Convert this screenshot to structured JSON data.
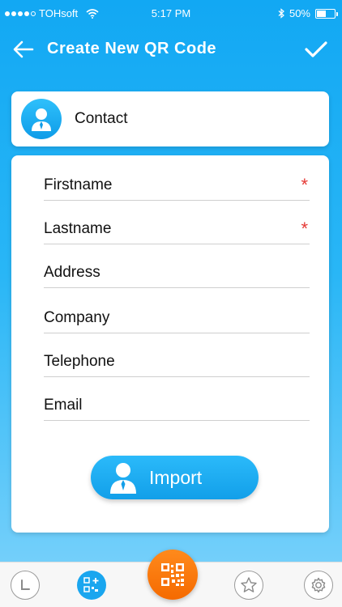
{
  "status_bar": {
    "carrier": "TOHsoft",
    "time": "5:17 PM",
    "battery_percent": "50%",
    "battery_level": 0.5
  },
  "header": {
    "title": "Create New QR Code",
    "back_icon": "arrow-left-icon",
    "confirm_icon": "checkmark-icon"
  },
  "type_card": {
    "label": "Contact",
    "icon": "person-icon"
  },
  "form": {
    "fields": [
      {
        "placeholder": "Firstname",
        "value": "",
        "required": true
      },
      {
        "placeholder": "Lastname",
        "value": "",
        "required": true
      },
      {
        "placeholder": "Address",
        "value": "",
        "required": false
      },
      {
        "placeholder": "Company",
        "value": "",
        "required": false
      },
      {
        "placeholder": "Telephone",
        "value": "",
        "required": false
      },
      {
        "placeholder": "Email",
        "value": "",
        "required": false
      }
    ],
    "required_mark": "*",
    "import_button": {
      "label": "Import",
      "icon": "person-icon"
    }
  },
  "bottom_nav": {
    "items": [
      {
        "icon": "history-clock-icon",
        "active": false
      },
      {
        "icon": "qr-create-icon",
        "active": true
      },
      {
        "icon": "qr-scan-icon",
        "active": false
      },
      {
        "icon": "star-icon",
        "active": false
      },
      {
        "icon": "gear-icon",
        "active": false
      }
    ]
  },
  "colors": {
    "primary": "#1aa6ef",
    "accent": "#f56a00",
    "required": "#e53935"
  }
}
